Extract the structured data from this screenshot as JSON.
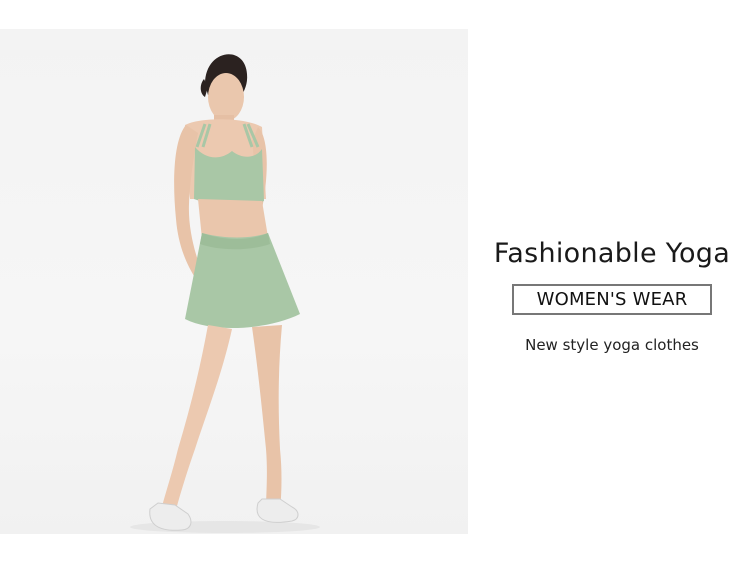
{
  "banner": {
    "headline": "Fashionable Yoga",
    "tag": "WOMEN'S WEAR",
    "subline": "New style yoga clothes"
  },
  "colors": {
    "outfit": "#a9c7a6",
    "background": "#ffffff",
    "photo_background": "#f3f3f3",
    "tag_border": "#777777"
  }
}
